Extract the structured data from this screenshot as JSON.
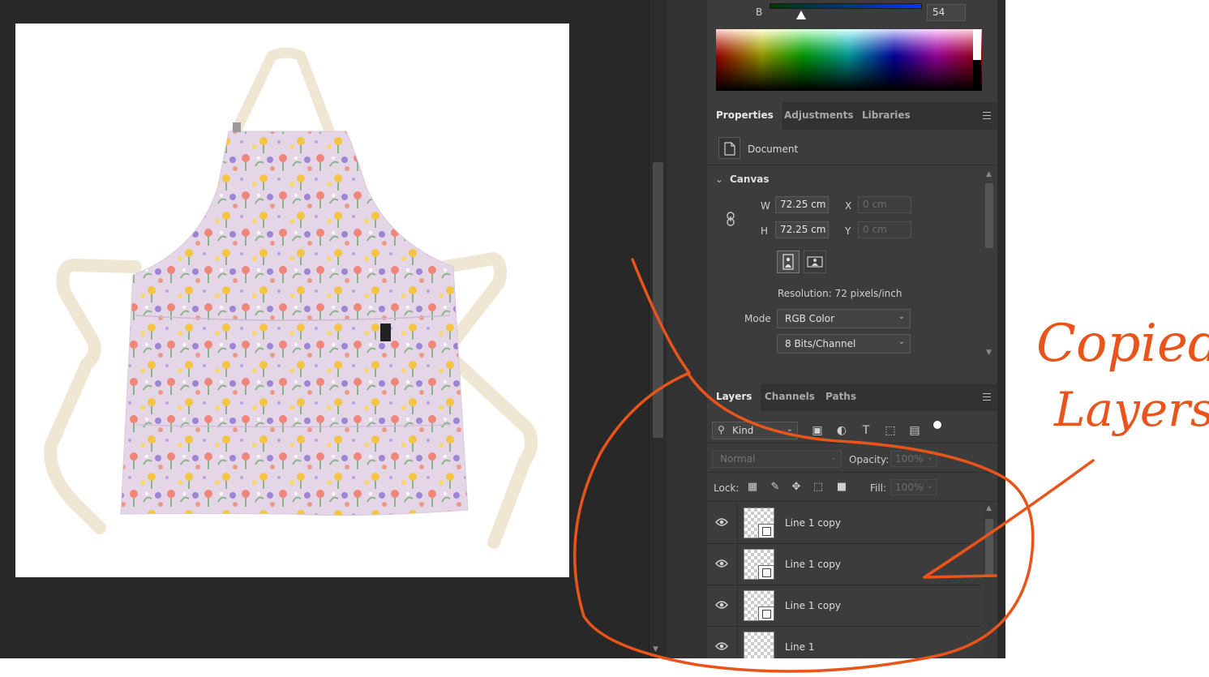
{
  "color_panel": {
    "channel_label": "B",
    "channel_value": "54",
    "slider_fraction": 0.21
  },
  "properties": {
    "tabs": [
      "Properties",
      "Adjustments",
      "Libraries"
    ],
    "active_tab": "Properties",
    "document_label": "Document",
    "canvas_section": "Canvas",
    "width_label": "W",
    "width_value": "72.25 cm",
    "height_label": "H",
    "height_value": "72.25 cm",
    "x_label": "X",
    "x_placeholder": "0 cm",
    "y_label": "Y",
    "y_placeholder": "0 cm",
    "resolution": "Resolution: 72 pixels/inch",
    "mode_label": "Mode",
    "mode_value": "RGB Color",
    "depth_value": "8 Bits/Channel"
  },
  "layers_panel": {
    "tabs": [
      "Layers",
      "Channels",
      "Paths"
    ],
    "active_tab": "Layers",
    "filter_kind": "Kind",
    "blend_mode": "Normal",
    "opacity_label": "Opacity:",
    "opacity_value": "100%",
    "lock_label": "Lock:",
    "fill_label": "Fill:",
    "fill_value": "100%",
    "layers": [
      {
        "name": "Line 1 copy",
        "visible": true
      },
      {
        "name": "Line 1 copy",
        "visible": true
      },
      {
        "name": "Line 1 copy",
        "visible": true
      },
      {
        "name": "Line 1",
        "visible": true
      }
    ]
  },
  "annotation": {
    "text_line1": "Copied",
    "text_line2": "Layers",
    "color": "#e8541a"
  },
  "icons": {
    "document": "document-icon",
    "link": "link-chain-icon",
    "portrait": "portrait-orientation-icon",
    "landscape": "landscape-orientation-icon",
    "search": "search-icon",
    "filters": [
      "image-filter-icon",
      "adjustment-filter-icon",
      "type-filter-icon",
      "shape-filter-icon",
      "smart-object-filter-icon"
    ],
    "locks": [
      "lock-transparent-icon",
      "lock-image-icon",
      "lock-position-icon",
      "lock-artboard-icon",
      "lock-all-icon"
    ]
  },
  "colors": {
    "panel_bg": "#3c3c3c",
    "tab_bar_bg": "#323232",
    "workspace_bg": "#282828",
    "annotation": "#e8541a"
  }
}
